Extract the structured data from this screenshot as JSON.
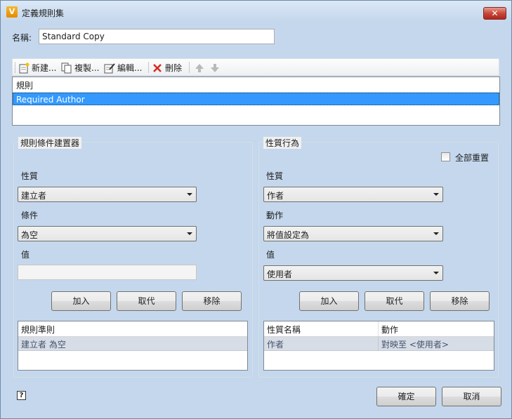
{
  "window": {
    "title": "定義規則集",
    "app_icon_letter": "V",
    "close_symbol": "✕"
  },
  "name_field": {
    "label": "名稱:",
    "value": "Standard Copy"
  },
  "toolbar": {
    "new_label": "新建...",
    "copy_label": "複製...",
    "edit_label": "編輯...",
    "delete_label": "刪除"
  },
  "rules_list": {
    "header": "規則",
    "items": [
      "Required Author"
    ]
  },
  "condition_builder": {
    "title": "規則條件建置器",
    "property_label": "性質",
    "property_value": "建立者",
    "condition_label": "條件",
    "condition_value": "為空",
    "value_label": "值",
    "value_value": "",
    "add_label": "加入",
    "replace_label": "取代",
    "remove_label": "移除",
    "criteria_header": "規則準則",
    "criteria_rows": [
      "建立者 為空"
    ]
  },
  "property_behavior": {
    "title": "性質行為",
    "reset_all_label": "全部重置",
    "property_label": "性質",
    "property_value": "作者",
    "action_label": "動作",
    "action_value": "將值設定為",
    "value_label": "值",
    "value_value": "使用者",
    "add_label": "加入",
    "replace_label": "取代",
    "remove_label": "移除",
    "grid_headers": [
      "性質名稱",
      "動作"
    ],
    "grid_rows": [
      {
        "name": "作者",
        "action": "對映至 <使用者>"
      }
    ]
  },
  "footer": {
    "help_symbol": "?",
    "ok_label": "確定",
    "cancel_label": "取消"
  },
  "colors": {
    "selection": "#3399ff",
    "titlebar": "#c4d7ec",
    "close": "#c7473a"
  }
}
